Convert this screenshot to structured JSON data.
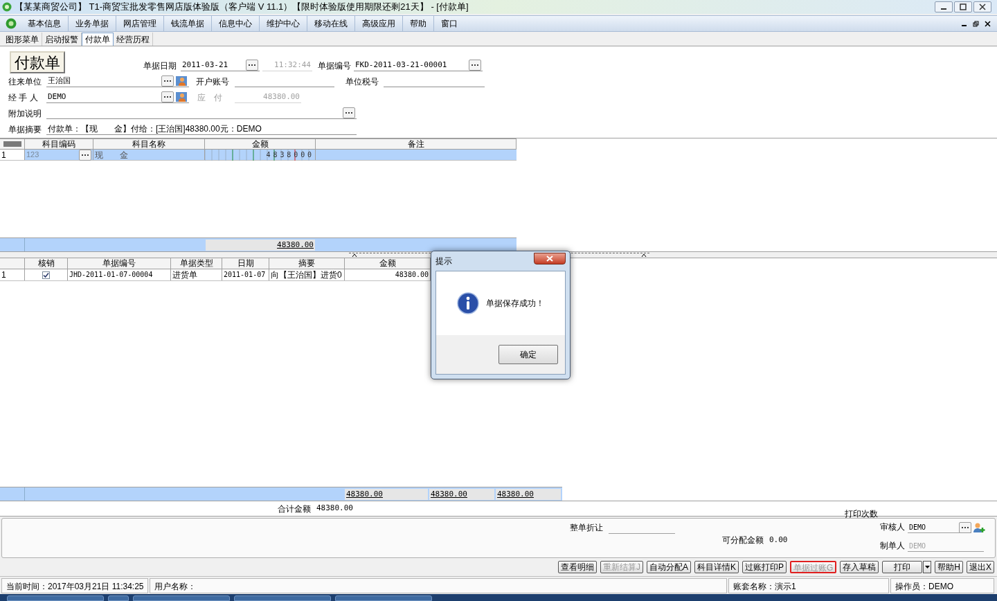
{
  "window": {
    "title": "【某某商贸公司】 T1-商贸宝批发零售网店版体验版（客户端 V 11.1）【限时体验版使用期限还剩21天】 - [付款单]"
  },
  "menu": [
    "基本信息",
    "业务单据",
    "网店管理",
    "钱流单据",
    "信息中心",
    "维护中心",
    "移动在线",
    "高级应用",
    "帮助",
    "窗口"
  ],
  "tabs": [
    {
      "label": "图形菜单",
      "selected": false
    },
    {
      "label": "启动报警",
      "selected": false
    },
    {
      "label": "付款单",
      "selected": true
    },
    {
      "label": "经营历程",
      "selected": false
    }
  ],
  "form": {
    "title": "付款单",
    "lines": [
      {
        "fields": [
          {
            "label": "单据日期",
            "value": "2011-03-21",
            "picker": true,
            "lookup": false,
            "disabled": false
          },
          {
            "value": "11:32:44",
            "picker": false,
            "lookup": false,
            "disabled": true
          },
          {
            "label": "单据编号",
            "value": "FKD-2011-03-21-00001",
            "picker": true,
            "lookup": false,
            "disabled": false
          }
        ]
      },
      {
        "fields": [
          {
            "label": "往来单位",
            "value": "王治国",
            "picker": true,
            "lookup": true,
            "disabled": false
          },
          {
            "label": "开户账号",
            "picker": false,
            "lookup": false,
            "disabled": false
          },
          {
            "label": "单位税号",
            "picker": false,
            "lookup": false,
            "disabled": false
          }
        ]
      },
      {
        "fields": [
          {
            "label": "经 手 人",
            "value": "DEMO",
            "picker": true,
            "lookup": true,
            "disabled": false
          },
          {
            "label": "应　付",
            "value": "48380.00",
            "picker": false,
            "lookup": false,
            "disabled": true
          }
        ]
      },
      {
        "fields": [
          {
            "label": "附加说明",
            "picker": true,
            "lookup": false,
            "disabled": false
          }
        ]
      },
      {
        "fields": [
          {
            "label": "单据摘要",
            "value": "付款单：【现　　金】付给：[王治国]48380.00元：DEMO",
            "picker": false,
            "lookup": false,
            "disabled": false
          }
        ]
      }
    ]
  },
  "entry_grid": {
    "columns": [
      "科目编码",
      "科目名称",
      "金额",
      "备注"
    ],
    "rows": [
      {
        "index": "1",
        "code": "123",
        "name": "现　　金",
        "amount": "4838000",
        "selected": true
      }
    ],
    "total": "48380.00"
  },
  "settle_grid": {
    "columns": [
      "核销",
      "单据编号",
      "单据类型",
      "日期",
      "摘要",
      "金额"
    ],
    "rows": [
      {
        "index": "1",
        "checked": true,
        "number": "JHD-2011-01-07-00004",
        "type": "进货单",
        "date": "2011-01-07",
        "summary": "向【王治国】进货0",
        "amount": "48380.00"
      }
    ],
    "totals": [
      "48380.00",
      "48380.00",
      "48380.00"
    ]
  },
  "summary": {
    "total_label": "合计金额",
    "total": "48380.00",
    "print_count_label": "打印次数"
  },
  "footer_panel": {
    "discount_label": "整单折让",
    "allocatable_label": "可分配金额",
    "allocatable": "0.00",
    "reviewer_label": "审核人",
    "reviewer": "DEMO",
    "maker_label": "制单人",
    "maker": "DEMO"
  },
  "buttons": [
    {
      "label": "查看明细",
      "disabled": false,
      "highlighted": false
    },
    {
      "label": "重新结算J",
      "disabled": true,
      "highlighted": false
    },
    {
      "label": "自动分配A",
      "disabled": false,
      "highlighted": false
    },
    {
      "label": "科目详情K",
      "disabled": false,
      "highlighted": false
    },
    {
      "label": "过账打印P",
      "disabled": false,
      "highlighted": false
    },
    {
      "label": "单据过账G",
      "disabled": true,
      "highlighted": true
    },
    {
      "label": "存入草稿",
      "disabled": false,
      "highlighted": false
    },
    {
      "label": "打印",
      "disabled": false,
      "highlighted": false
    },
    {
      "label": "帮助H",
      "disabled": false,
      "highlighted": false
    },
    {
      "label": "退出X",
      "disabled": false,
      "highlighted": false
    }
  ],
  "status_bar": [
    "当前时间：2017年03月21日 11:34:25",
    "用户名称：",
    "账套名称：演示1",
    "操作员：DEMO"
  ],
  "dialog": {
    "title": "提示",
    "message": "单据保存成功！",
    "button": "确定"
  }
}
